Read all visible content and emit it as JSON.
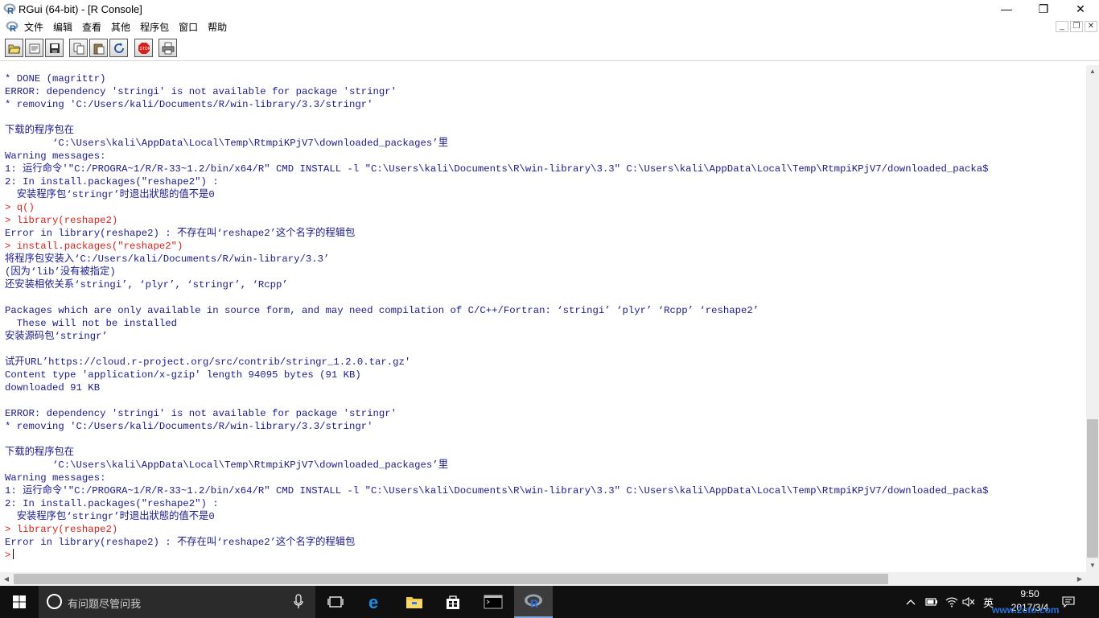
{
  "window": {
    "title": "RGui (64-bit) - [R Console]",
    "minimize": "—",
    "maximize": "❐",
    "close": "✕"
  },
  "menu": {
    "items": [
      "文件",
      "编辑",
      "查看",
      "其他",
      "程序包",
      "窗口",
      "帮助"
    ]
  },
  "toolbar": {
    "icons": [
      "open-script-icon",
      "load-workspace-icon",
      "save-workspace-icon",
      "copy-icon",
      "paste-icon",
      "copy-paste-icon",
      "stop-icon",
      "print-icon"
    ]
  },
  "console": {
    "lines": [
      {
        "text": "* DONE (magrittr)",
        "kind": "out"
      },
      {
        "text": "ERROR: dependency 'stringi' is not available for package 'stringr'",
        "kind": "out"
      },
      {
        "text": "* removing 'C:/Users/kali/Documents/R/win-library/3.3/stringr'",
        "kind": "out"
      },
      {
        "text": "",
        "kind": "out"
      },
      {
        "text": "下载的程序包在",
        "kind": "out"
      },
      {
        "text": "        ‘C:\\Users\\kali\\AppData\\Local\\Temp\\RtmpiKPjV7\\downloaded_packages’里",
        "kind": "out"
      },
      {
        "text": "Warning messages:",
        "kind": "out"
      },
      {
        "text": "1: 运行命令'\"C:/PROGRA~1/R/R-33~1.2/bin/x64/R\" CMD INSTALL -l \"C:\\Users\\kali\\Documents\\R\\win-library\\3.3\" C:\\Users\\kali\\AppData\\Local\\Temp\\RtmpiKPjV7/downloaded_packa$",
        "kind": "out"
      },
      {
        "text": "2: In install.packages(\"reshape2\") :",
        "kind": "out"
      },
      {
        "text": "  安装程序包‘stringr’时退出狀態的值不是0",
        "kind": "out"
      },
      {
        "text": "> q()",
        "kind": "cmd"
      },
      {
        "text": "> library(reshape2)",
        "kind": "cmd"
      },
      {
        "text": "Error in library(reshape2) : 不存在叫‘reshape2’这个名字的程辑包",
        "kind": "out"
      },
      {
        "text": "> install.packages(\"reshape2\")",
        "kind": "cmd"
      },
      {
        "text": "将程序包安装入‘C:/Users/kali/Documents/R/win-library/3.3’",
        "kind": "out"
      },
      {
        "text": "(因为‘lib’没有被指定)",
        "kind": "out"
      },
      {
        "text": "还安装相依关系‘stringi’, ‘plyr’, ‘stringr’, ‘Rcpp’",
        "kind": "out"
      },
      {
        "text": "",
        "kind": "out"
      },
      {
        "text": "Packages which are only available in source form, and may need compilation of C/C++/Fortran: ‘stringi’ ‘plyr’ ‘Rcpp’ ‘reshape2’",
        "kind": "out"
      },
      {
        "text": "  These will not be installed",
        "kind": "out"
      },
      {
        "text": "安装源码包‘stringr’",
        "kind": "out"
      },
      {
        "text": "",
        "kind": "out"
      },
      {
        "text": "试开URL’https://cloud.r-project.org/src/contrib/stringr_1.2.0.tar.gz'",
        "kind": "out"
      },
      {
        "text": "Content type 'application/x-gzip' length 94095 bytes (91 KB)",
        "kind": "out"
      },
      {
        "text": "downloaded 91 KB",
        "kind": "out"
      },
      {
        "text": "",
        "kind": "out"
      },
      {
        "text": "ERROR: dependency 'stringi' is not available for package 'stringr'",
        "kind": "out"
      },
      {
        "text": "* removing 'C:/Users/kali/Documents/R/win-library/3.3/stringr'",
        "kind": "out"
      },
      {
        "text": "",
        "kind": "out"
      },
      {
        "text": "下载的程序包在",
        "kind": "out"
      },
      {
        "text": "        ‘C:\\Users\\kali\\AppData\\Local\\Temp\\RtmpiKPjV7\\downloaded_packages’里",
        "kind": "out"
      },
      {
        "text": "Warning messages:",
        "kind": "out"
      },
      {
        "text": "1: 运行命令'\"C:/PROGRA~1/R/R-33~1.2/bin/x64/R\" CMD INSTALL -l \"C:\\Users\\kali\\Documents\\R\\win-library\\3.3\" C:\\Users\\kali\\AppData\\Local\\Temp\\RtmpiKPjV7/downloaded_packa$",
        "kind": "out"
      },
      {
        "text": "2: In install.packages(\"reshape2\") :",
        "kind": "out"
      },
      {
        "text": "  安装程序包‘stringr’时退出狀態的值不是0",
        "kind": "out"
      },
      {
        "text": "> library(reshape2)",
        "kind": "cmd"
      },
      {
        "text": "Error in library(reshape2) : 不存在叫‘reshape2’这个名字的程辑包",
        "kind": "out"
      }
    ],
    "prompt": ">"
  },
  "taskbar": {
    "search_placeholder": "有问题尽管问我",
    "ime": "英",
    "time": "9:50",
    "date": "2017/3/4",
    "watermark": "www.2cto.com"
  }
}
